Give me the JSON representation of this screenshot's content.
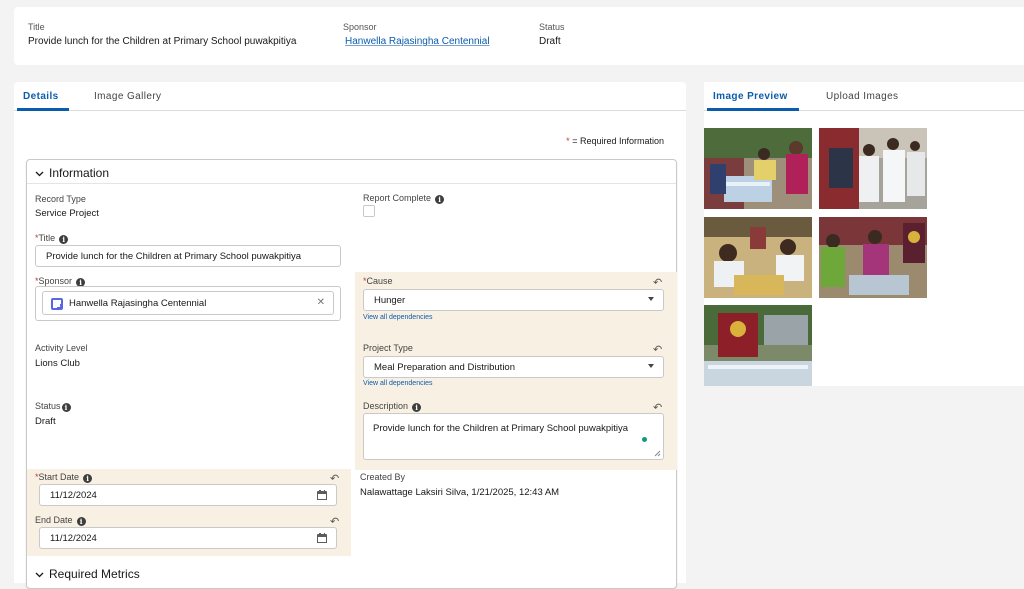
{
  "header": {
    "title_label": "Title",
    "title_value": "Provide lunch for the Children at Primary School puwakpitiya",
    "sponsor_label": "Sponsor",
    "sponsor_value": "Hanwella Rajasingha Centennial",
    "status_label": "Status",
    "status_value": "Draft"
  },
  "left_tabs": [
    {
      "label": "Details",
      "active": true
    },
    {
      "label": "Image Gallery",
      "active": false
    }
  ],
  "right_tabs": [
    {
      "label": "Image Preview",
      "active": true
    },
    {
      "label": "Upload Images",
      "active": false
    }
  ],
  "required_note": {
    "star": "*",
    "text": " = Required Information"
  },
  "sections": {
    "information": "Information",
    "required_metrics": "Required Metrics"
  },
  "fields": {
    "record_type": {
      "label": "Record Type",
      "value": "Service Project"
    },
    "report_complete": {
      "label": "Report Complete",
      "checked": false
    },
    "title": {
      "label": "Title",
      "value": "Provide lunch for the Children at Primary School puwakpitiya"
    },
    "sponsor": {
      "label": "Sponsor",
      "value": "Hanwella Rajasingha Centennial"
    },
    "cause": {
      "label": "Cause",
      "value": "Hunger",
      "link": "View all dependencies"
    },
    "activity_level": {
      "label": "Activity Level",
      "value": "Lions Club"
    },
    "project_type": {
      "label": "Project Type",
      "value": "Meal Preparation and Distribution",
      "link": "View all dependencies"
    },
    "status": {
      "label": "Status",
      "value": "Draft"
    },
    "description": {
      "label": "Description",
      "value": "Provide lunch for the Children at Primary School puwakpitiya"
    },
    "start_date": {
      "label": "Start Date",
      "value": "11/12/2024"
    },
    "end_date": {
      "label": "End Date",
      "value": "11/12/2024"
    },
    "created_by": {
      "label": "Created By",
      "value": "Nalawattage Laksiri Silva, 1/21/2025, 12:43 AM"
    }
  },
  "icons": {
    "info": "i",
    "undo": "↶",
    "chevron": "⌄",
    "clear": "✕"
  },
  "colors": {
    "brand_blue": "#0b5cab",
    "edited_highlight": "#f8f0e3",
    "required_red": "#c23934"
  },
  "images": [
    {
      "name": "event-photo-1"
    },
    {
      "name": "event-photo-2"
    },
    {
      "name": "event-photo-3"
    },
    {
      "name": "event-photo-4"
    },
    {
      "name": "event-photo-5"
    }
  ]
}
